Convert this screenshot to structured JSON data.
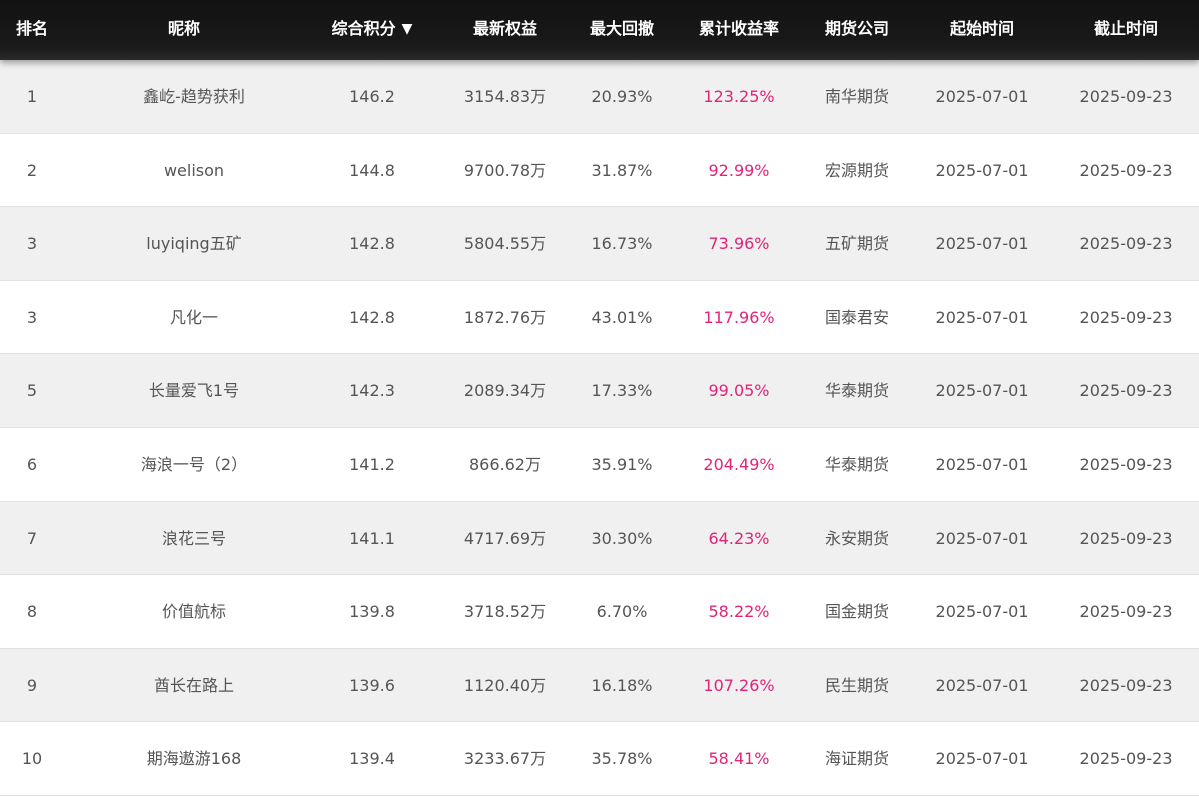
{
  "table": {
    "headers": {
      "rank": "排名",
      "nickname": "昵称",
      "score": "综合积分",
      "equity": "最新权益",
      "drawdown": "最大回撤",
      "return_rate": "累计收益率",
      "company": "期货公司",
      "start": "起始时间",
      "end": "截止时间"
    },
    "sort_icon": "▼",
    "accent_color": "#e0247a",
    "rows": [
      {
        "rank": "1",
        "nickname": "鑫屹-趋势获利",
        "score": "146.2",
        "equity": "3154.83万",
        "drawdown": "20.93%",
        "return_rate": "123.25%",
        "company": "南华期货",
        "start": "2025-07-01",
        "end": "2025-09-23"
      },
      {
        "rank": "2",
        "nickname": "welison",
        "score": "144.8",
        "equity": "9700.78万",
        "drawdown": "31.87%",
        "return_rate": "92.99%",
        "company": "宏源期货",
        "start": "2025-07-01",
        "end": "2025-09-23"
      },
      {
        "rank": "3",
        "nickname": "luyiqing五矿",
        "score": "142.8",
        "equity": "5804.55万",
        "drawdown": "16.73%",
        "return_rate": "73.96%",
        "company": "五矿期货",
        "start": "2025-07-01",
        "end": "2025-09-23"
      },
      {
        "rank": "3",
        "nickname": "凡化一",
        "score": "142.8",
        "equity": "1872.76万",
        "drawdown": "43.01%",
        "return_rate": "117.96%",
        "company": "国泰君安",
        "start": "2025-07-01",
        "end": "2025-09-23"
      },
      {
        "rank": "5",
        "nickname": "长量爱飞1号",
        "score": "142.3",
        "equity": "2089.34万",
        "drawdown": "17.33%",
        "return_rate": "99.05%",
        "company": "华泰期货",
        "start": "2025-07-01",
        "end": "2025-09-23"
      },
      {
        "rank": "6",
        "nickname": "海浪一号（2）",
        "score": "141.2",
        "equity": "866.62万",
        "drawdown": "35.91%",
        "return_rate": "204.49%",
        "company": "华泰期货",
        "start": "2025-07-01",
        "end": "2025-09-23"
      },
      {
        "rank": "7",
        "nickname": "浪花三号",
        "score": "141.1",
        "equity": "4717.69万",
        "drawdown": "30.30%",
        "return_rate": "64.23%",
        "company": "永安期货",
        "start": "2025-07-01",
        "end": "2025-09-23"
      },
      {
        "rank": "8",
        "nickname": "价值航标",
        "score": "139.8",
        "equity": "3718.52万",
        "drawdown": "6.70%",
        "return_rate": "58.22%",
        "company": "国金期货",
        "start": "2025-07-01",
        "end": "2025-09-23"
      },
      {
        "rank": "9",
        "nickname": "酋长在路上",
        "score": "139.6",
        "equity": "1120.40万",
        "drawdown": "16.18%",
        "return_rate": "107.26%",
        "company": "民生期货",
        "start": "2025-07-01",
        "end": "2025-09-23"
      },
      {
        "rank": "10",
        "nickname": "期海遨游168",
        "score": "139.4",
        "equity": "3233.67万",
        "drawdown": "35.78%",
        "return_rate": "58.41%",
        "company": "海证期货",
        "start": "2025-07-01",
        "end": "2025-09-23"
      }
    ]
  }
}
